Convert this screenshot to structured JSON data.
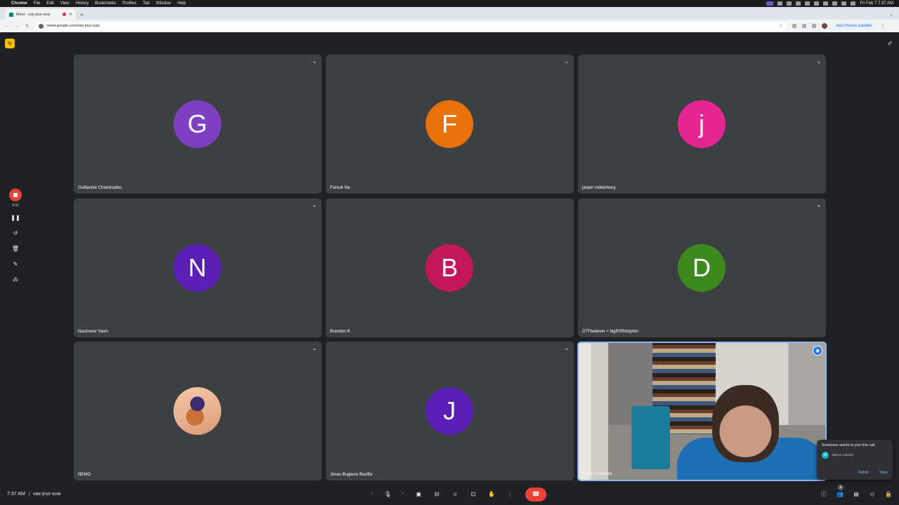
{
  "menubar": {
    "app": "Chrome",
    "items": [
      "File",
      "Edit",
      "View",
      "History",
      "Bookmarks",
      "Profiles",
      "Tab",
      "Window",
      "Help"
    ],
    "datetime": "Fri Feb 7  7:37 AM"
  },
  "browser": {
    "tab_title": "Meet - vax-jnur-xuw",
    "url": "meet.google.com/vax-jnur-xuw",
    "update_label": "New Chrome available"
  },
  "tiles": [
    {
      "name": "Guillaume Chaminadas",
      "initial": "G",
      "color": "#7e3fc2"
    },
    {
      "name": "Farouk Ha",
      "initial": "F",
      "color": "#e8710a"
    },
    {
      "name": "jasper valkenburg",
      "initial": "j",
      "color": "#e52592"
    },
    {
      "name": "Nasimoov Yasin",
      "initial": "N",
      "color": "#5b1fb5"
    },
    {
      "name": "Brandon K",
      "initial": "B",
      "color": "#c2185b"
    },
    {
      "name": "DTFbeliever + bigRSRdolphin",
      "initial": "D",
      "color": "#3c8a1e"
    },
    {
      "name": "NEMO",
      "initial": "",
      "color": "#e7b08f"
    },
    {
      "name": "Jonas Bugtene Boulifa",
      "initial": "J",
      "color": "#5b1fb5"
    },
    {
      "name": "Nevin Freeman",
      "initial": "",
      "color": "#1f6fb5"
    }
  ],
  "recording": {
    "time": "0:00"
  },
  "join_request": {
    "title": "Someone wants to join this call",
    "person": "Meme Indexer",
    "person_initial": "M",
    "admit": "Admit",
    "view": "View"
  },
  "bottom": {
    "clock": "7:37 AM",
    "separator": "|",
    "meeting_code": "vax-jnur-xuw",
    "people_count": "9"
  },
  "icons": {
    "mute": "mic-off-icon",
    "pin": "pin-icon",
    "mic": "mic-icon",
    "camera": "camera-icon"
  }
}
